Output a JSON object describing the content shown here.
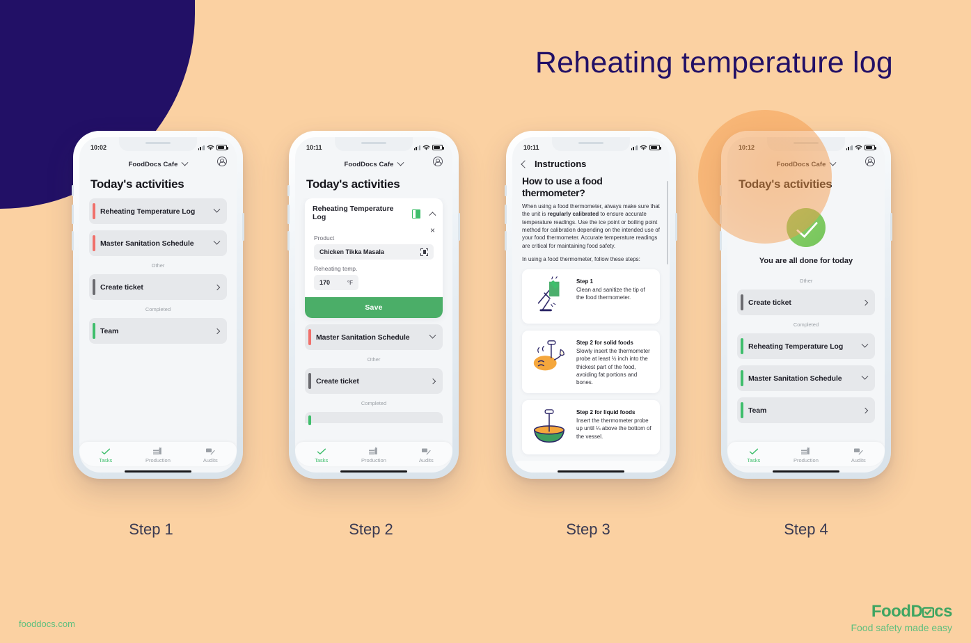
{
  "page": {
    "title": "Reheating temperature log",
    "background_color": "#FBD1A2",
    "navy_color": "#221066",
    "accent_green": "#3FBE6C"
  },
  "footer": {
    "site": "fooddocs.com",
    "logo_part1": "Food",
    "logo_part2": "D",
    "logo_part3": "cs",
    "tagline": "Food safety made easy"
  },
  "captions": {
    "step1": "Step 1",
    "step2": "Step 2",
    "step3": "Step 3",
    "step4": "Step 4"
  },
  "phone1": {
    "time": "10:02",
    "brand": "FoodDocs Cafe",
    "screen_title": "Today's activities",
    "rows": [
      {
        "label": "Reheating Temperature Log",
        "bar": "red",
        "chevron": "down"
      },
      {
        "label": "Master Sanitation Schedule",
        "bar": "red",
        "chevron": "down"
      }
    ],
    "section_other": "Other",
    "other_rows": [
      {
        "label": "Create ticket",
        "bar": "gray",
        "chevron": "right"
      }
    ],
    "section_completed": "Completed",
    "completed_rows": [
      {
        "label": "Team",
        "bar": "green",
        "chevron": "right"
      }
    ],
    "nav": [
      {
        "label": "Tasks",
        "icon": "check-icon",
        "active": true
      },
      {
        "label": "Production",
        "icon": "production-icon",
        "active": false
      },
      {
        "label": "Audits",
        "icon": "audits-icon",
        "active": false
      }
    ]
  },
  "phone2": {
    "time": "10:11",
    "brand": "FoodDocs Cafe",
    "screen_title": "Today's activities",
    "card": {
      "title": "Reheating Temperature Log",
      "instructions_icon": "book-icon",
      "close_label": "×",
      "product_label": "Product",
      "product_value": "Chicken Tikka Masala",
      "scan_icon": "barcode-scan-icon",
      "temp_label": "Reheating temp.",
      "temp_value": "170",
      "temp_unit": "°F",
      "save_label": "Save"
    },
    "rows": [
      {
        "label": "Master Sanitation Schedule",
        "bar": "red",
        "chevron": "down"
      }
    ],
    "section_other": "Other",
    "other_rows": [
      {
        "label": "Create ticket",
        "bar": "gray",
        "chevron": "right"
      }
    ],
    "section_completed": "Completed",
    "nav": [
      {
        "label": "Tasks",
        "icon": "check-icon",
        "active": true
      },
      {
        "label": "Production",
        "icon": "production-icon",
        "active": false
      },
      {
        "label": "Audits",
        "icon": "audits-icon",
        "active": false
      }
    ]
  },
  "phone3": {
    "time": "10:11",
    "header_title": "Instructions",
    "back_icon": "chevron-left-icon",
    "question": "How to use a food thermometer?",
    "intro_a": "When using a food thermometer, always make sure that the unit is ",
    "intro_bold": "regularly calibrated",
    "intro_b": " to ensure accurate temperature readings. Use the ice point or boiling point method for calibration depending on the intended use of your food thermometer. Accurate temperature readings are critical for maintaining food safety.",
    "lead": "In using a food thermometer, follow these steps:",
    "steps": [
      {
        "title": "Step 1",
        "desc": "Clean and sanitize the tip of the food thermometer.",
        "illustration": "thermometer-cleaning-illustration"
      },
      {
        "title": "Step 2 for solid foods",
        "desc": "Slowly insert the thermometer probe at least ½ inch into the thickest part of the food, avoiding fat portions and bones.",
        "illustration": "chicken-leg-probe-illustration"
      },
      {
        "title": "Step 2 for liquid foods",
        "desc": "Insert the thermometer probe up until ¼ above the bottom of the vessel.",
        "illustration": "soup-bowl-probe-illustration"
      }
    ]
  },
  "phone4": {
    "time": "10:12",
    "brand": "FoodDocs Cafe",
    "screen_title": "Today's activities",
    "done_icon": "check-circle-icon",
    "done_text": "You are all done for today",
    "section_other": "Other",
    "other_rows": [
      {
        "label": "Create ticket",
        "bar": "gray",
        "chevron": "right"
      }
    ],
    "section_completed": "Completed",
    "completed_rows": [
      {
        "label": "Reheating Temperature Log",
        "bar": "green",
        "chevron": "down"
      },
      {
        "label": "Master Sanitation Schedule",
        "bar": "green",
        "chevron": "down"
      },
      {
        "label": "Team",
        "bar": "green",
        "chevron": "right"
      }
    ],
    "nav": [
      {
        "label": "Tasks",
        "icon": "check-icon",
        "active": true
      },
      {
        "label": "Production",
        "icon": "production-icon",
        "active": false
      },
      {
        "label": "Audits",
        "icon": "audits-icon",
        "active": false
      }
    ]
  }
}
